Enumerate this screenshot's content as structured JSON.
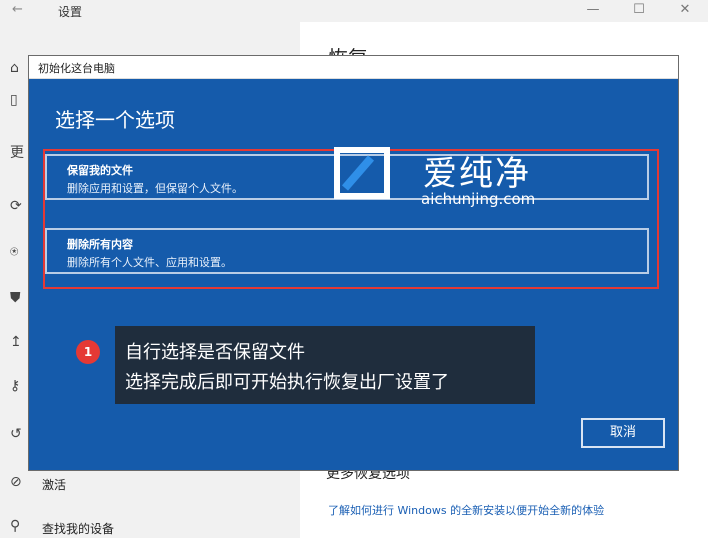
{
  "settings_window": {
    "title": "设置",
    "back_icon": "arrow-left-icon",
    "controls": [
      "—",
      "☐",
      "✕"
    ],
    "partial_heading": "恢复",
    "left_rail": [
      {
        "icon": "home-icon",
        "glyph": "⌂",
        "label": ""
      },
      {
        "icon": "search-box",
        "glyph": "▯",
        "label": ""
      },
      {
        "icon": "",
        "glyph": "",
        "label": "更"
      },
      {
        "icon": "sync-icon",
        "glyph": "⟳",
        "label": ""
      },
      {
        "icon": "delivery-icon",
        "glyph": "⍟",
        "label": ""
      },
      {
        "icon": "shield-icon",
        "glyph": "⛊",
        "label": ""
      },
      {
        "icon": "upload-icon",
        "glyph": "↥",
        "label": ""
      },
      {
        "icon": "key-icon",
        "glyph": "⚷",
        "label": ""
      },
      {
        "icon": "recovery-icon",
        "glyph": "↺",
        "label": ""
      },
      {
        "icon": "activation-icon",
        "glyph": "⊘",
        "label": "激活"
      },
      {
        "icon": "find-device-icon",
        "glyph": "⚲",
        "label": "查找我的设备"
      }
    ],
    "more_options_partial": "更多恢复选项",
    "learn_link": "了解如何进行 Windows 的全新安装以便开始全新的体验"
  },
  "dialog": {
    "title": "初始化这台电脑",
    "heading": "选择一个选项",
    "options": [
      {
        "title": "保留我的文件",
        "desc": "删除应用和设置，但保留个人文件。"
      },
      {
        "title": "删除所有内容",
        "desc": "删除所有个人文件、应用和设置。"
      }
    ],
    "cancel_label": "取消"
  },
  "annotation": {
    "badge": "1",
    "line1": "自行选择是否保留文件",
    "line2": "选择完成后即可开始执行恢复出厂设置了",
    "highlight_color": "#e53935"
  },
  "watermark": {
    "brand": "爱纯净",
    "url": "aichunjing.com"
  },
  "colors": {
    "dialog_bg": "#155bab",
    "tooltip_bg": "#1f2d3d"
  }
}
